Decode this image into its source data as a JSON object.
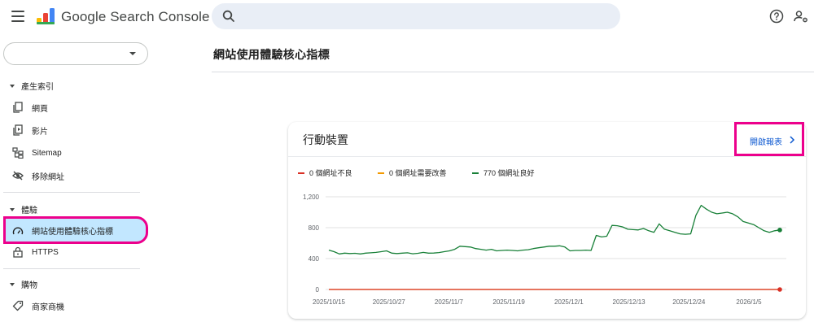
{
  "header": {
    "app_title": "Google Search Console",
    "search_placeholder": ""
  },
  "sidebar": {
    "property_value": "",
    "sections": [
      {
        "label": "產生索引",
        "items": [
          "網頁",
          "影片",
          "Sitemap",
          "移除網址"
        ]
      },
      {
        "label": "體驗",
        "items": [
          "網站使用體驗核心指標",
          "HTTPS"
        ]
      },
      {
        "label": "購物",
        "items": [
          "商家商機"
        ]
      }
    ]
  },
  "main": {
    "page_title": "網站使用體驗核心指標",
    "card": {
      "title": "行動裝置",
      "open_report_label": "開啟報表",
      "legend": [
        {
          "label": "0 個網址不良",
          "color": "#d93025"
        },
        {
          "label": "0 個網址需要改善",
          "color": "#f29900"
        },
        {
          "label": "770 個網址良好",
          "color": "#188038"
        }
      ]
    }
  },
  "chart_data": {
    "type": "line",
    "x_tick_labels": [
      "2025/10/15",
      "2025/10/27",
      "2025/11/7",
      "2025/11/19",
      "2025/12/1",
      "2025/12/13",
      "2025/12/24",
      "2026/1/5"
    ],
    "y_tick_labels": [
      "0",
      "400",
      "800",
      "1,200"
    ],
    "ylim": [
      0,
      1200
    ],
    "grid": true,
    "legend_position": "top-left",
    "x": [
      "2025/10/15",
      "2025/10/16",
      "2025/10/17",
      "2025/10/18",
      "2025/10/19",
      "2025/10/20",
      "2025/10/21",
      "2025/10/22",
      "2025/10/23",
      "2025/10/24",
      "2025/10/25",
      "2025/10/26",
      "2025/10/27",
      "2025/10/28",
      "2025/10/29",
      "2025/10/30",
      "2025/10/31",
      "2025/11/1",
      "2025/11/2",
      "2025/11/3",
      "2025/11/4",
      "2025/11/5",
      "2025/11/6",
      "2025/11/7",
      "2025/11/8",
      "2025/11/9",
      "2025/11/10",
      "2025/11/11",
      "2025/11/12",
      "2025/11/13",
      "2025/11/14",
      "2025/11/15",
      "2025/11/16",
      "2025/11/17",
      "2025/11/18",
      "2025/11/19",
      "2025/11/20",
      "2025/11/21",
      "2025/11/22",
      "2025/11/23",
      "2025/11/24",
      "2025/11/25",
      "2025/11/26",
      "2025/11/27",
      "2025/11/28",
      "2025/11/29",
      "2025/11/30",
      "2025/12/1",
      "2025/12/2",
      "2025/12/3",
      "2025/12/4",
      "2025/12/5",
      "2025/12/6",
      "2025/12/7",
      "2025/12/8",
      "2025/12/9",
      "2025/12/10",
      "2025/12/11",
      "2025/12/12",
      "2025/12/13",
      "2025/12/14",
      "2025/12/15",
      "2025/12/16",
      "2025/12/17",
      "2025/12/18",
      "2025/12/19",
      "2025/12/20",
      "2025/12/21",
      "2025/12/22",
      "2025/12/23",
      "2025/12/24",
      "2025/12/25",
      "2025/12/26",
      "2025/12/27",
      "2025/12/28",
      "2025/12/29",
      "2025/12/30",
      "2025/12/31",
      "2026/1/1",
      "2026/1/2",
      "2026/1/3",
      "2026/1/4",
      "2026/1/5",
      "2026/1/6",
      "2026/1/7",
      "2026/1/8",
      "2026/1/9"
    ],
    "series": [
      {
        "name": "770 個網址良好",
        "color": "#188038",
        "values": [
          510,
          490,
          460,
          470,
          465,
          468,
          460,
          470,
          475,
          480,
          490,
          500,
          470,
          465,
          470,
          475,
          462,
          468,
          480,
          470,
          472,
          478,
          490,
          500,
          520,
          560,
          555,
          550,
          530,
          520,
          510,
          520,
          500,
          505,
          510,
          505,
          500,
          510,
          515,
          530,
          540,
          550,
          560,
          560,
          565,
          550,
          500,
          505,
          505,
          510,
          505,
          700,
          680,
          690,
          830,
          825,
          810,
          780,
          775,
          770,
          790,
          760,
          740,
          850,
          780,
          760,
          740,
          720,
          715,
          720,
          960,
          1090,
          1040,
          1000,
          980,
          990,
          1000,
          980,
          940,
          880,
          860,
          840,
          800,
          760,
          740,
          760,
          770
        ]
      },
      {
        "name": "0 個網址需要改善",
        "color": "#f29900",
        "values": [
          0,
          0
        ]
      },
      {
        "name": "0 個網址不良",
        "color": "#d93025",
        "values": [
          0,
          0
        ]
      }
    ]
  }
}
